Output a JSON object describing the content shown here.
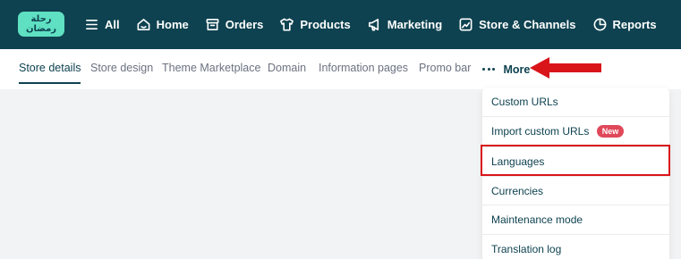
{
  "logo": {
    "line1": "رحلة",
    "line2": "رمضان"
  },
  "nav": [
    {
      "label": "All",
      "icon": "menu-icon"
    },
    {
      "label": "Home",
      "icon": "home-icon"
    },
    {
      "label": "Orders",
      "icon": "orders-box-icon"
    },
    {
      "label": "Products",
      "icon": "tshirt-icon"
    },
    {
      "label": "Marketing",
      "icon": "megaphone-icon"
    },
    {
      "label": "Store & Channels",
      "icon": "store-channels-icon"
    },
    {
      "label": "Reports",
      "icon": "pie-chart-icon"
    }
  ],
  "tabs": [
    {
      "label": "Store details",
      "active": true
    },
    {
      "label": "Store design"
    },
    {
      "label": "Theme Marketplace"
    },
    {
      "label": "Domain"
    },
    {
      "label": "Information pages"
    },
    {
      "label": "Promo bar"
    }
  ],
  "more": {
    "label": "More",
    "icon": "more-dots-icon"
  },
  "dropdown": [
    {
      "label": "Custom URLs"
    },
    {
      "label": "Import custom URLs",
      "badge": "New"
    },
    {
      "label": "Languages",
      "highlighted": true
    },
    {
      "label": "Currencies"
    },
    {
      "label": "Maintenance mode"
    },
    {
      "label": "Translation log"
    }
  ],
  "colors": {
    "topbar": "#0e4250",
    "accent": "#5fe0c2",
    "badge": "#e0485a",
    "annotation": "#d9151a"
  }
}
